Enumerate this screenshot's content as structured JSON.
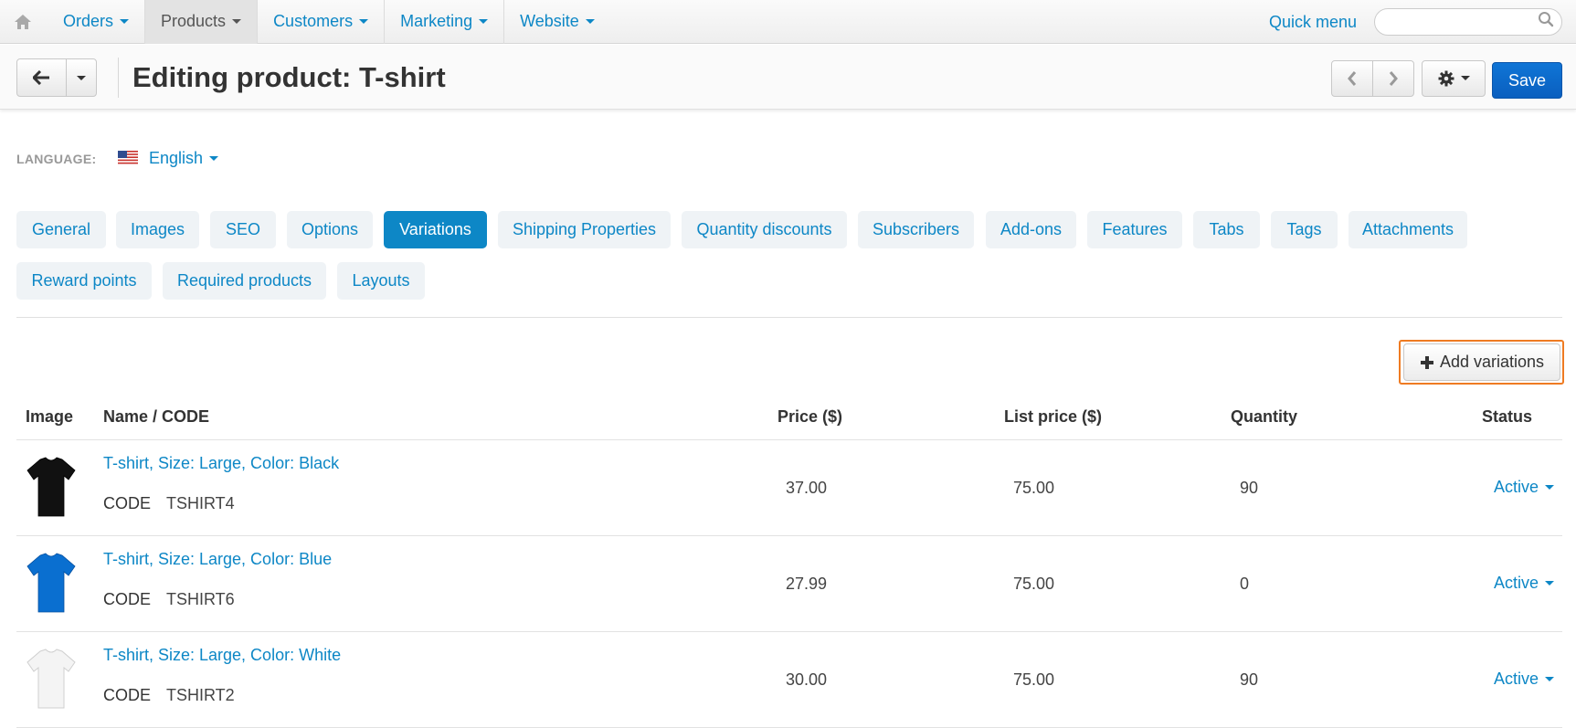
{
  "topnav": {
    "home_icon": "home-icon",
    "items": [
      {
        "label": "Orders"
      },
      {
        "label": "Products"
      },
      {
        "label": "Customers"
      },
      {
        "label": "Marketing"
      },
      {
        "label": "Website"
      }
    ],
    "active_item": "Products",
    "quick_menu": "Quick menu",
    "search_value": ""
  },
  "titlebar": {
    "title": "Editing product: T-shirt",
    "save_label": "Save"
  },
  "language": {
    "label": "LANGUAGE:",
    "value": "English",
    "flag_icon": "us-flag-icon"
  },
  "tabs": [
    {
      "label": "General"
    },
    {
      "label": "Images"
    },
    {
      "label": "SEO"
    },
    {
      "label": "Options"
    },
    {
      "label": "Variations"
    },
    {
      "label": "Shipping Properties"
    },
    {
      "label": "Quantity discounts"
    },
    {
      "label": "Subscribers"
    },
    {
      "label": "Add-ons"
    },
    {
      "label": "Features"
    },
    {
      "label": "Tabs"
    },
    {
      "label": "Tags"
    },
    {
      "label": "Attachments"
    },
    {
      "label": "Reward points"
    },
    {
      "label": "Required products"
    },
    {
      "label": "Layouts"
    }
  ],
  "active_tab": "Variations",
  "add_variations_label": "Add variations",
  "table": {
    "headers": [
      "Image",
      "Name / CODE",
      "Price ($)",
      "List price ($)",
      "Quantity",
      "Status"
    ],
    "rows": [
      {
        "name": "T-shirt, Size: Large, Color: Black",
        "code_label": "CODE",
        "code": "TSHIRT4",
        "price": "37.00",
        "list_price": "75.00",
        "quantity": "90",
        "status": "Active",
        "shirt_color": "#111111"
      },
      {
        "name": "T-shirt, Size: Large, Color: Blue",
        "code_label": "CODE",
        "code": "TSHIRT6",
        "price": "27.99",
        "list_price": "75.00",
        "quantity": "0",
        "status": "Active",
        "shirt_color": "#0a6fd0"
      },
      {
        "name": "T-shirt, Size: Large, Color: White",
        "code_label": "CODE",
        "code": "TSHIRT2",
        "price": "30.00",
        "list_price": "75.00",
        "quantity": "90",
        "status": "Active",
        "shirt_color": "#f4f4f4"
      }
    ]
  },
  "colors": {
    "link": "#0d87c6",
    "save": "#0a63c6",
    "highlight": "#ef7b22"
  }
}
